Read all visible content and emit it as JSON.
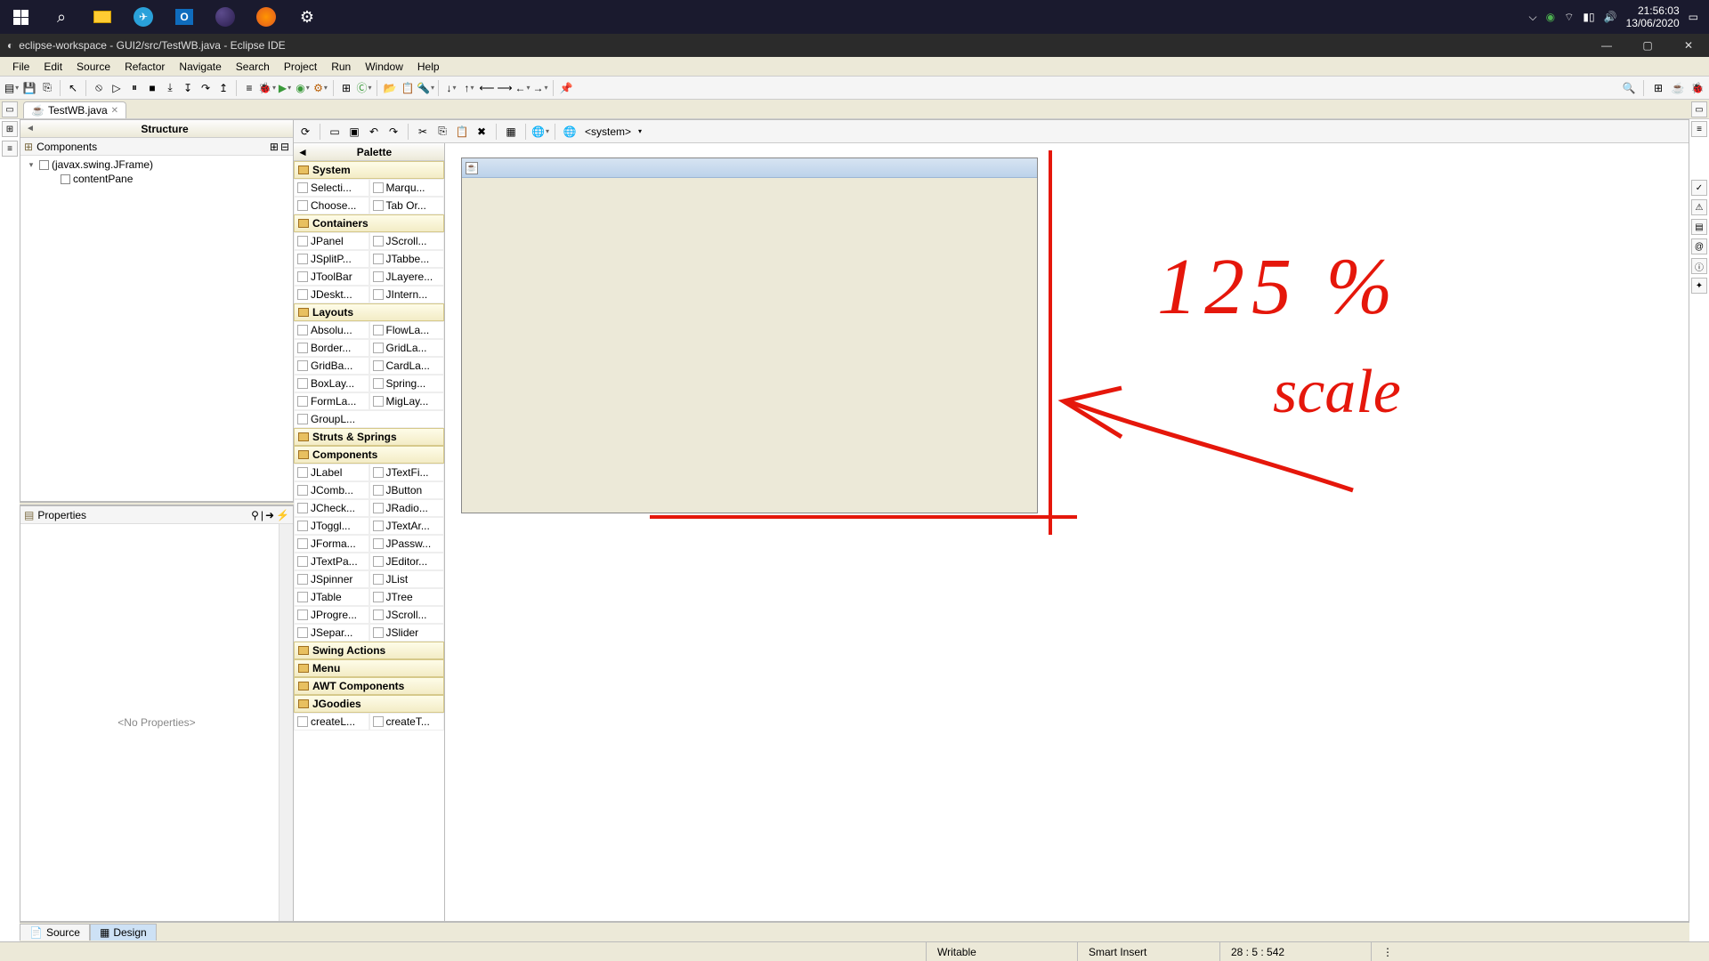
{
  "taskbar": {
    "clock_time": "21:56:03",
    "clock_date": "13/06/2020"
  },
  "window": {
    "title": "eclipse-workspace - GUI2/src/TestWB.java - Eclipse IDE"
  },
  "menubar": [
    "File",
    "Edit",
    "Source",
    "Refactor",
    "Navigate",
    "Search",
    "Project",
    "Run",
    "Window",
    "Help"
  ],
  "editor_tab": {
    "label": "TestWB.java"
  },
  "structure": {
    "title": "Structure",
    "subheader": "Components",
    "tree": [
      {
        "indent": 0,
        "twisty": "▾",
        "label": "(javax.swing.JFrame)"
      },
      {
        "indent": 1,
        "twisty": "",
        "label": "contentPane"
      }
    ]
  },
  "properties": {
    "title": "Properties",
    "empty_text": "<No Properties>"
  },
  "palette": {
    "title": "Palette",
    "categories": [
      {
        "name": "System",
        "items": [
          "Selecti...",
          "Marqu...",
          "Choose...",
          "Tab Or..."
        ]
      },
      {
        "name": "Containers",
        "items": [
          "JPanel",
          "JScroll...",
          "JSplitP...",
          "JTabbe...",
          "JToolBar",
          "JLayere...",
          "JDeskt...",
          "JIntern..."
        ]
      },
      {
        "name": "Layouts",
        "items": [
          "Absolu...",
          "FlowLa...",
          "Border...",
          "GridLa...",
          "GridBa...",
          "CardLa...",
          "BoxLay...",
          "Spring...",
          "FormLa...",
          "MigLay...",
          "GroupL..."
        ]
      },
      {
        "name": "Struts & Springs",
        "items": []
      },
      {
        "name": "Components",
        "items": [
          "JLabel",
          "JTextFi...",
          "JComb...",
          "JButton",
          "JCheck...",
          "JRadio...",
          "JToggl...",
          "JTextAr...",
          "JForma...",
          "JPassw...",
          "JTextPa...",
          "JEditor...",
          "JSpinner",
          "JList",
          "JTable",
          "JTree",
          "JProgre...",
          "JScroll...",
          "JSepar...",
          "JSlider"
        ]
      },
      {
        "name": "Swing Actions",
        "items": []
      },
      {
        "name": "Menu",
        "items": []
      },
      {
        "name": "AWT Components",
        "items": []
      },
      {
        "name": "JGoodies",
        "items": [
          "createL...",
          "createT..."
        ]
      }
    ]
  },
  "editor_toolbar": {
    "system_label": "<system>"
  },
  "bottom_tabs": {
    "source": "Source",
    "design": "Design"
  },
  "status": {
    "writable": "Writable",
    "insert": "Smart Insert",
    "pos": "28 : 5 : 542"
  },
  "annotation": {
    "line1": "125 %",
    "line2": "scale"
  }
}
